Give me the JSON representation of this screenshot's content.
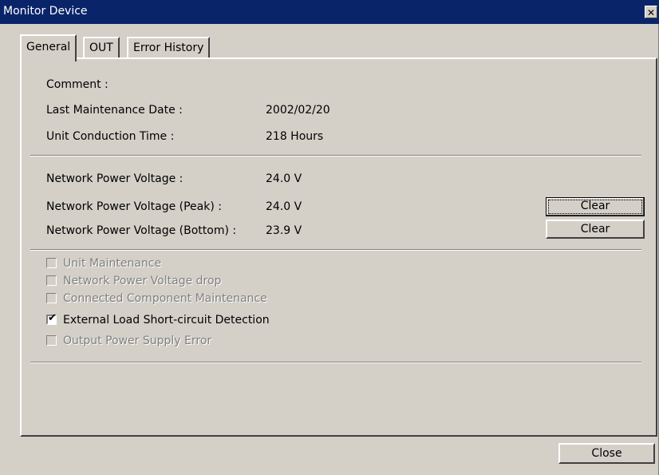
{
  "window": {
    "title": "Monitor Device",
    "close_glyph": "✕"
  },
  "tabs": [
    {
      "label": "General",
      "active": true
    },
    {
      "label": "OUT",
      "active": false
    },
    {
      "label": "Error History",
      "active": false
    }
  ],
  "info": {
    "comment_label": "Comment :",
    "comment_value": "",
    "last_maintenance_label": "Last Maintenance Date :",
    "last_maintenance_value": "2002/02/20",
    "conduction_label": "Unit Conduction Time :",
    "conduction_value": "218 Hours"
  },
  "voltage": {
    "network_label": "Network Power Voltage :",
    "network_value": "24.0 V",
    "peak_label": "Network Power Voltage (Peak) :",
    "peak_value": "24.0 V",
    "bottom_label": "Network Power Voltage (Bottom) :",
    "bottom_value": "23.9 V",
    "clear_peak_label": "Clear",
    "clear_bottom_label": "Clear"
  },
  "checks": [
    {
      "label": "Unit Maintenance",
      "checked": false,
      "enabled": false
    },
    {
      "label": "Network Power Voltage drop",
      "checked": false,
      "enabled": false
    },
    {
      "label": "Connected Component Maintenance",
      "checked": false,
      "enabled": false
    },
    {
      "label": "External Load Short-circuit Detection",
      "checked": true,
      "enabled": true
    },
    {
      "label": "Output Power Supply Error",
      "checked": false,
      "enabled": false
    }
  ],
  "footer": {
    "close_label": "Close"
  },
  "colors": {
    "titlebar": "#0a246a",
    "face": "#d4d0c8"
  }
}
